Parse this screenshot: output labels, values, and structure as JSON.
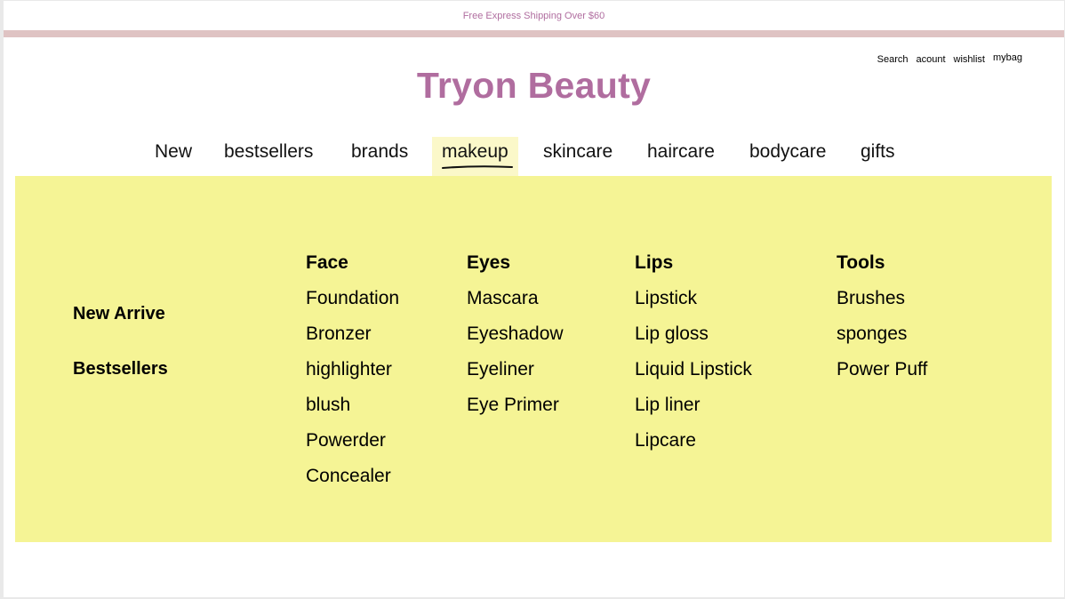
{
  "promo": {
    "text": "Free Express Shipping Over $60"
  },
  "utility_nav": {
    "search": "Search",
    "account": "acount",
    "wishlist": "wishlist",
    "bag": "mybag"
  },
  "brand": {
    "name": "Tryon Beauty"
  },
  "nav": [
    "New",
    "bestsellers",
    "brands",
    "makeup",
    "skincare",
    "haircare",
    "bodycare",
    "gifts"
  ],
  "active_nav": "makeup",
  "mega_menu": {
    "side_links": [
      "New Arrive",
      "Bestsellers"
    ],
    "columns": [
      {
        "heading": "Face",
        "items": [
          "Foundation",
          "Bronzer",
          "highlighter",
          "blush",
          "Powerder",
          "Concealer"
        ]
      },
      {
        "heading": "Eyes",
        "items": [
          "Mascara",
          "Eyeshadow",
          "Eyeliner",
          "Eye Primer"
        ]
      },
      {
        "heading": "Lips",
        "items": [
          "Lipstick",
          "Lip gloss",
          "Liquid Lipstick",
          "Lip liner",
          "Lipcare"
        ]
      },
      {
        "heading": "Tools",
        "items": [
          "Brushes",
          "sponges",
          "Power Puff"
        ]
      }
    ]
  },
  "colors": {
    "brand": "#b06d9f",
    "promo_stripe": "#dfc3c3",
    "mega_menu_bg": "#f5f495",
    "active_tab_bg": "#fbf8c9"
  }
}
